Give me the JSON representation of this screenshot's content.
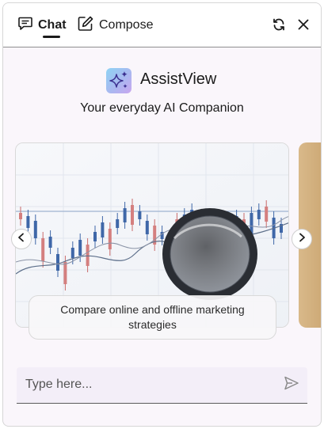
{
  "header": {
    "tabs": [
      {
        "label": "Chat",
        "icon": "chat-icon",
        "active": true
      },
      {
        "label": "Compose",
        "icon": "compose-icon",
        "active": false
      }
    ],
    "actions": {
      "refresh_icon": "refresh-icon",
      "close_icon": "close-icon"
    }
  },
  "brand": {
    "name": "AssistView",
    "tagline": "Your everyday AI Companion"
  },
  "carousel": {
    "slides": [
      {
        "caption": "Compare online and offline marketing strategies",
        "image": "stock-chart-with-magnifying-glass"
      }
    ]
  },
  "composer": {
    "placeholder": "Type here..."
  },
  "colors": {
    "accent": "#1b1b1b",
    "panel_bg": "#faf6fb",
    "input_bg": "#f3eef8"
  }
}
